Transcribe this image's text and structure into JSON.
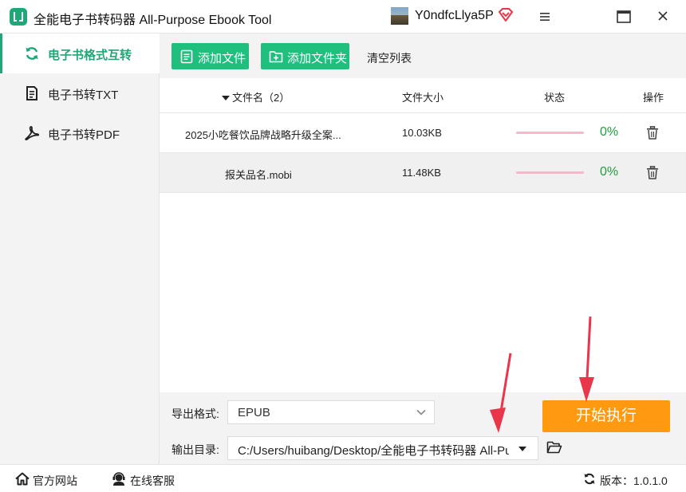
{
  "window": {
    "title": "全能电子书转码器 All-Purpose Ebook Tool",
    "username": "Y0ndfcLlya5P",
    "vip_icon": "diamond-icon",
    "controls": [
      "menu-icon",
      "minimize-icon",
      "close-icon"
    ]
  },
  "sidebar": {
    "items": [
      {
        "label": "电子书格式互转",
        "icon": "refresh-icon",
        "active": true
      },
      {
        "label": "电子书转TXT",
        "icon": "document-icon",
        "active": false
      },
      {
        "label": "电子书转PDF",
        "icon": "pdf-icon",
        "active": false
      }
    ]
  },
  "toolbar": {
    "add_file": "添加文件",
    "add_folder": "添加文件夹",
    "clear_list": "清空列表"
  },
  "table": {
    "headers": {
      "filename": "文件名（2）",
      "size": "文件大小",
      "status": "状态",
      "action": "操作"
    },
    "rows": [
      {
        "name": "2025小吃餐饮品牌战略升级全案...",
        "size": "10.03KB",
        "progress": "0%"
      },
      {
        "name": "报关品名.mobi",
        "size": "11.48KB",
        "progress": "0%"
      }
    ]
  },
  "export": {
    "format_label": "导出格式:",
    "format_value": "EPUB",
    "dir_label": "输出目录:",
    "dir_value": "C:/Users/huibang/Desktop/全能电子书转码器 All-Pu",
    "start": "开始执行"
  },
  "statusbar": {
    "website": "官方网站",
    "support": "在线客服",
    "version": "版本：1.0.1.0"
  },
  "colors": {
    "accent": "#1fa776",
    "button_green": "#1fbf7e",
    "start_orange": "#ff9910",
    "progress_green": "#1e9e3c",
    "annotation_red": "#e8364b"
  }
}
